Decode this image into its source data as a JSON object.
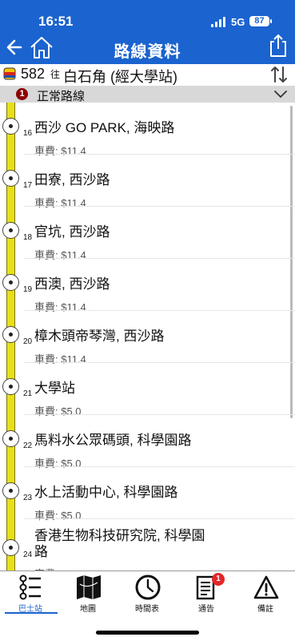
{
  "status": {
    "time": "16:51",
    "network": "5G",
    "battery": "87"
  },
  "nav": {
    "title": "路線資料"
  },
  "route": {
    "number": "582",
    "to_word": "往",
    "destination": "白石角 (經大學站)"
  },
  "variant": {
    "number": "1",
    "label": "正常路線"
  },
  "stops": [
    {
      "seq": "16",
      "name": "西沙 GO PARK, 海映路",
      "fare": "車費: $11.4"
    },
    {
      "seq": "17",
      "name": "田寮, 西沙路",
      "fare": "車費: $11.4"
    },
    {
      "seq": "18",
      "name": "官坑, 西沙路",
      "fare": "車費: $11.4"
    },
    {
      "seq": "19",
      "name": "西澳, 西沙路",
      "fare": "車費: $11.4"
    },
    {
      "seq": "20",
      "name": "樟木頭帝琴灣, 西沙路",
      "fare": "車費: $11.4"
    },
    {
      "seq": "21",
      "name": "大學站",
      "fare": "車費: $5.0"
    },
    {
      "seq": "22",
      "name": "馬料水公眾碼頭, 科學園路",
      "fare": "車費: $5.0"
    },
    {
      "seq": "23",
      "name": "水上活動中心, 科學園路",
      "fare": "車費: $5.0"
    },
    {
      "seq": "24",
      "name": "香港生物科技研究院, 科學園路",
      "fare": "車費"
    }
  ],
  "tabs": [
    {
      "label": "巴士站",
      "icon": "bus-stop-list-icon",
      "active": true
    },
    {
      "label": "地圖",
      "icon": "map-icon"
    },
    {
      "label": "時間表",
      "icon": "clock-icon"
    },
    {
      "label": "通告",
      "icon": "notice-icon",
      "badge": "1"
    },
    {
      "label": "備註",
      "icon": "warning-icon"
    }
  ],
  "colors": {
    "primary": "#1b63cf",
    "route_line": "#e8df1a",
    "badge": "#e4262a",
    "variant_badge": "#8b0000"
  }
}
